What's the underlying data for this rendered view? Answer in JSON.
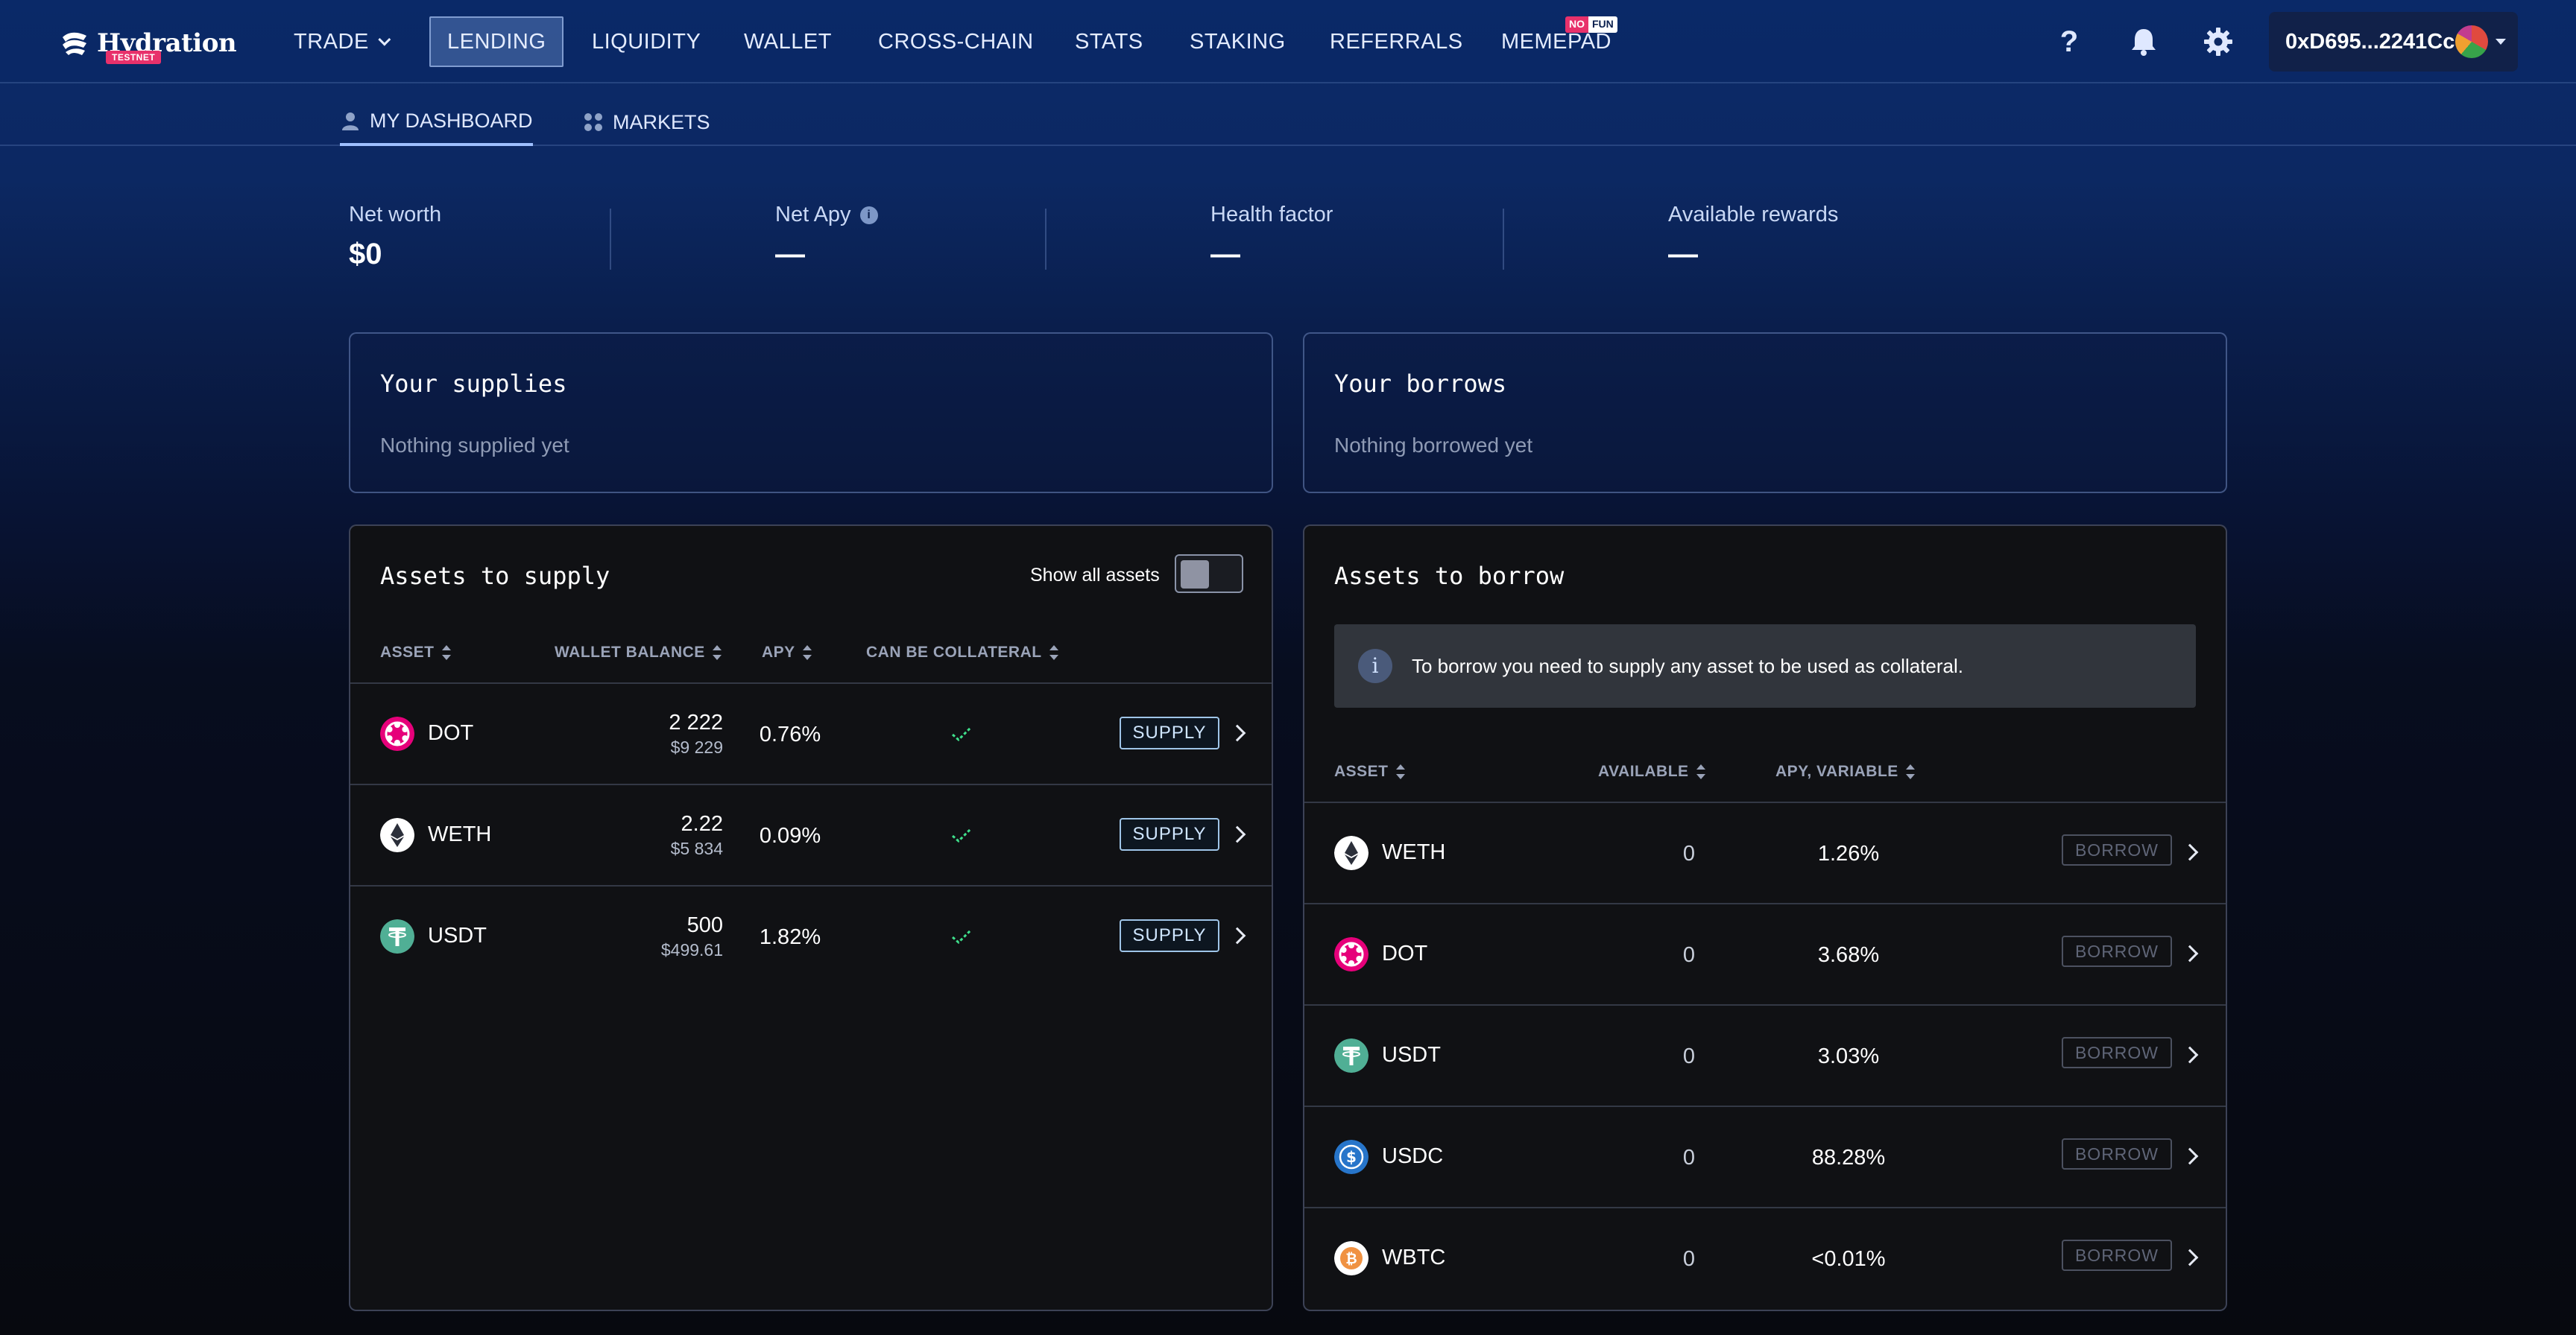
{
  "brand": {
    "name": "Hydration",
    "badge": "TESTNET"
  },
  "nav": {
    "items": [
      {
        "label": "TRADE",
        "has_dropdown": true
      },
      {
        "label": "LENDING",
        "active": true
      },
      {
        "label": "LIQUIDITY"
      },
      {
        "label": "WALLET"
      },
      {
        "label": "CROSS-CHAIN"
      },
      {
        "label": "STATS"
      },
      {
        "label": "STAKING"
      },
      {
        "label": "REFERRALS"
      },
      {
        "label": "MEMEPAD"
      }
    ],
    "memepad_badge": {
      "no": "NO",
      "fun": "FUN"
    },
    "help_icon": "?",
    "account": "0xD695...2241Cc"
  },
  "subnav": {
    "tabs": [
      {
        "label": "MY DASHBOARD",
        "active": true,
        "icon": "user-icon"
      },
      {
        "label": "MARKETS",
        "icon": "grid-dots-icon"
      }
    ]
  },
  "stats": {
    "net_worth": {
      "label": "Net worth",
      "value": "$0"
    },
    "net_apy": {
      "label": "Net Apy",
      "value": "—"
    },
    "health_factor": {
      "label": "Health factor",
      "value": "—"
    },
    "available_rewards": {
      "label": "Available rewards",
      "value": "—"
    }
  },
  "supplies": {
    "title": "Your supplies",
    "empty": "Nothing supplied yet"
  },
  "borrows": {
    "title": "Your borrows",
    "empty": "Nothing borrowed yet"
  },
  "assets_to_supply": {
    "title": "Assets to supply",
    "toggle_label": "Show all assets",
    "toggle_on": false,
    "columns": [
      "ASSET",
      "WALLET BALANCE",
      "APY",
      "CAN BE COLLATERAL"
    ],
    "button_label": "SUPPLY",
    "rows": [
      {
        "asset": "DOT",
        "balance": "2 222",
        "balance_usd": "$9 229",
        "apy": "0.76%",
        "collateral": true,
        "icon": "dot-icon",
        "color": "#e6007a"
      },
      {
        "asset": "WETH",
        "balance": "2.22",
        "balance_usd": "$5 834",
        "apy": "0.09%",
        "collateral": true,
        "icon": "eth-icon",
        "color": "#ffffff"
      },
      {
        "asset": "USDT",
        "balance": "500",
        "balance_usd": "$499.61",
        "apy": "1.82%",
        "collateral": true,
        "icon": "usdt-icon",
        "color": "#50af95"
      }
    ]
  },
  "assets_to_borrow": {
    "title": "Assets to borrow",
    "notice": "To borrow you need to supply any asset to be used as collateral.",
    "columns": [
      "ASSET",
      "AVAILABLE",
      "APY, VARIABLE"
    ],
    "button_label": "BORROW",
    "rows": [
      {
        "asset": "WETH",
        "available": "0",
        "apy": "1.26%",
        "icon": "eth-icon",
        "color": "#ffffff"
      },
      {
        "asset": "DOT",
        "available": "0",
        "apy": "3.68%",
        "icon": "dot-icon",
        "color": "#e6007a"
      },
      {
        "asset": "USDT",
        "available": "0",
        "apy": "3.03%",
        "icon": "usdt-icon",
        "color": "#50af95"
      },
      {
        "asset": "USDC",
        "available": "0",
        "apy": "88.28%",
        "icon": "usdc-icon",
        "color": "#2775ca"
      },
      {
        "asset": "WBTC",
        "available": "0",
        "apy": "<0.01%",
        "icon": "wbtc-icon",
        "color": "#f09242"
      }
    ]
  },
  "colors": {
    "accent": "#9fc5e8",
    "positive": "#3fe08c",
    "badge_red": "#e8316b"
  }
}
